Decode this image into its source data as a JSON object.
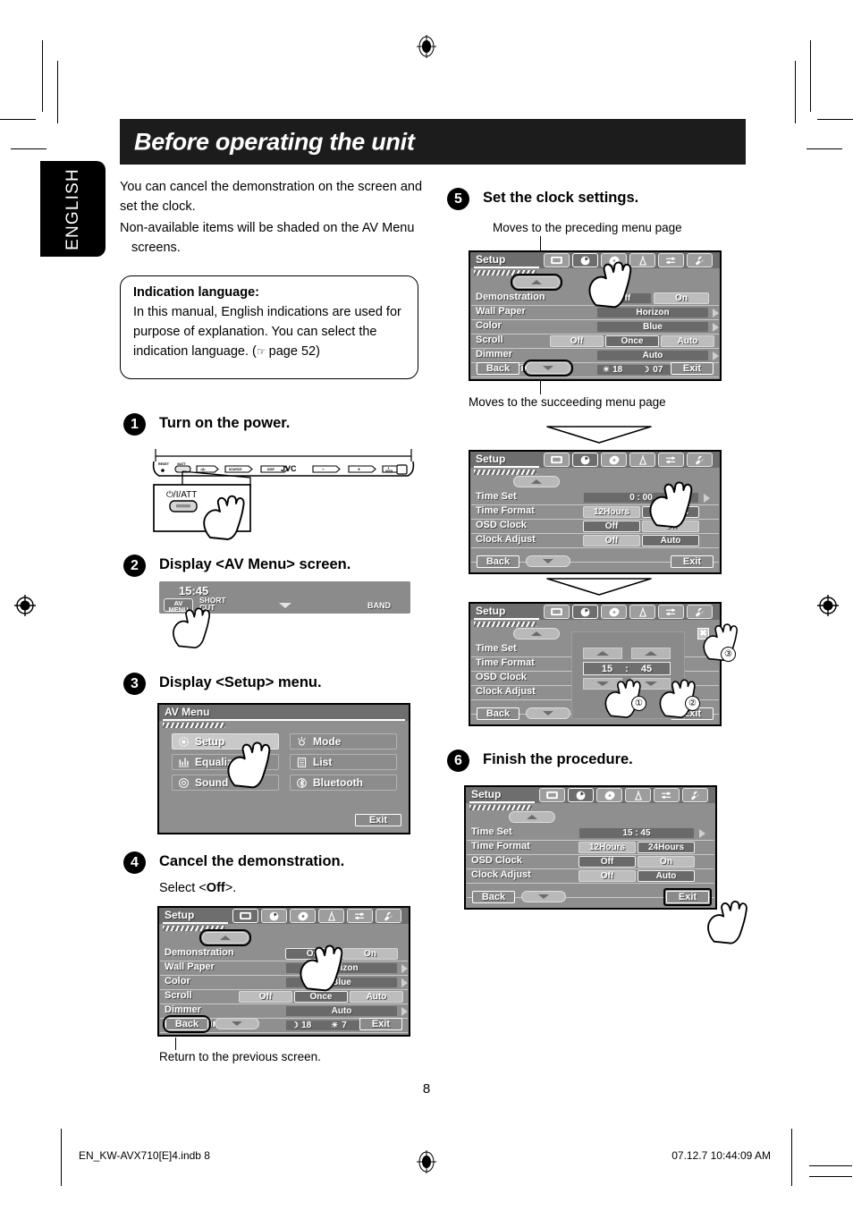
{
  "meta": {
    "language_tab": "ENGLISH",
    "page_number": "8",
    "footer_left": "EN_KW-AVX710[E]4.indb   8",
    "footer_right": "07.12.7   10:44:09 AM"
  },
  "header": {
    "title": "Before operating the unit"
  },
  "intro": {
    "line1": "You can cancel the demonstration on the screen and set the clock.",
    "bullet1": "Non-available items will be shaded on the AV Menu screens."
  },
  "note_box": {
    "heading": "Indication language:",
    "body_part1": "In this manual, English indications are used for purpose of explanation. You can select the indication language. (",
    "body_part2": " page 52)",
    "symbol": "☞"
  },
  "steps": {
    "s1": {
      "num": "1",
      "title": "Turn on the power."
    },
    "s2": {
      "num": "2",
      "title": "Display <AV Menu> screen."
    },
    "s3": {
      "num": "3",
      "title": "Display <Setup> menu."
    },
    "s4": {
      "num": "4",
      "title": "Cancel the demonstration.",
      "subtext_pre": "Select <",
      "subtext_bold": "Off",
      "subtext_post": ">.",
      "caption": "Return to the previous screen."
    },
    "s5": {
      "num": "5",
      "title": "Set the clock settings.",
      "caption_top": "Moves to the preceding menu page",
      "caption_bottom": "Moves to the succeeding menu page"
    },
    "s6": {
      "num": "6",
      "title": "Finish the procedure."
    }
  },
  "faceplate": {
    "brand": "JVC",
    "reset_label": "RESET",
    "att_label": "/I/ATT",
    "keys": [
      "◁/▷",
      "SOURCE",
      "DISP",
      "–",
      "+",
      "▲/OPEN"
    ],
    "callout_label": "/I/ATT"
  },
  "source_bar": {
    "clock": "15:45",
    "av_menu_line1": "AV",
    "av_menu_line2": "MENU",
    "shortcut_line1": "SHORT",
    "shortcut_line2": "CUT",
    "band": "BAND"
  },
  "av_menu_screen": {
    "title": "AV Menu",
    "buttons": [
      {
        "label": "Setup",
        "icon": "setup-gear-icon",
        "selected": true
      },
      {
        "label": "Mode",
        "icon": "mode-sun-icon",
        "selected": false
      },
      {
        "label": "Equalizer",
        "icon": "equalizer-bars-icon",
        "selected": false
      },
      {
        "label": "List",
        "icon": "list-icon",
        "selected": false
      },
      {
        "label": "Sound",
        "icon": "sound-speaker-icon",
        "selected": false
      },
      {
        "label": "Bluetooth",
        "icon": "bluetooth-icon",
        "selected": false
      }
    ],
    "exit": "Exit"
  },
  "setup_tabs": [
    "screen-tab-icon",
    "clock-tab-icon",
    "disc-tab-icon",
    "tuner-tab-icon",
    "audio-tab-icon",
    "wrench-tab-icon"
  ],
  "setup_screen_demo": {
    "title": "Setup",
    "selected_tab": 0,
    "rows": [
      {
        "name": "Demonstration",
        "type": "two",
        "options": [
          "Off",
          "On"
        ],
        "selected": 0
      },
      {
        "name": "Wall Paper",
        "type": "wide",
        "value": "Horizon",
        "arrow": true
      },
      {
        "name": "Color",
        "type": "wide",
        "value": "Blue",
        "arrow": true
      },
      {
        "name": "Scroll",
        "type": "three",
        "options": [
          "Off",
          "Once",
          "Auto"
        ],
        "selected": 1
      },
      {
        "name": "Dimmer",
        "type": "wide",
        "value": "Auto",
        "arrow": true
      },
      {
        "name": "Dimmer Time Set",
        "type": "dimmer",
        "night": "18",
        "day": "7"
      }
    ],
    "back": "Back",
    "exit": "Exit"
  },
  "setup_screen_demo_step5": {
    "title": "Setup",
    "selected_tab": 1,
    "rows": [
      {
        "name": "Demonstration",
        "type": "two",
        "options": [
          "Off",
          "On"
        ],
        "selected": 1
      },
      {
        "name": "Wall Paper",
        "type": "wide",
        "value": "Horizon",
        "arrow": true
      },
      {
        "name": "Color",
        "type": "wide",
        "value": "Blue",
        "arrow": true
      },
      {
        "name": "Scroll",
        "type": "three",
        "options": [
          "Off",
          "Once",
          "Auto"
        ],
        "selected": 1
      },
      {
        "name": "Dimmer",
        "type": "wide",
        "value": "Auto",
        "arrow": true
      },
      {
        "name": "Dimmer Time Set",
        "type": "dimmer",
        "night": "18",
        "day": "07"
      }
    ],
    "back": "Back",
    "exit": "Exit"
  },
  "clock_screen_a": {
    "title": "Setup",
    "selected_tab": 1,
    "rows": [
      {
        "name": "Time Set",
        "type": "wide",
        "value": "0   :   00",
        "arrow": true
      },
      {
        "name": "Time Format",
        "type": "two",
        "options": [
          "12Hours",
          "24Hours"
        ],
        "selected": 1
      },
      {
        "name": "OSD Clock",
        "type": "two",
        "options": [
          "Off",
          "On"
        ],
        "selected": 0
      },
      {
        "name": "Clock Adjust",
        "type": "two",
        "options": [
          "Off",
          "Auto"
        ],
        "selected": 1
      }
    ],
    "back": "Back",
    "exit": "Exit"
  },
  "clock_screen_b": {
    "title": "Setup",
    "selected_tab": 1,
    "rows": [
      {
        "name": "Time Set"
      },
      {
        "name": "Time Format"
      },
      {
        "name": "OSD Clock"
      },
      {
        "name": "Clock Adjust"
      }
    ],
    "popup": {
      "hours": "15",
      "sep": ":",
      "minutes": "45",
      "close": "✖"
    },
    "markers": [
      "①",
      "②",
      "③"
    ],
    "back": "Back",
    "exit": "Exit"
  },
  "clock_screen_final": {
    "title": "Setup",
    "selected_tab": 1,
    "rows": [
      {
        "name": "Time Set",
        "type": "wide",
        "value": "15   :   45",
        "arrow": true
      },
      {
        "name": "Time Format",
        "type": "two",
        "options": [
          "12Hours",
          "24Hours"
        ],
        "selected": 1
      },
      {
        "name": "OSD Clock",
        "type": "two",
        "options": [
          "Off",
          "On"
        ],
        "selected": 0
      },
      {
        "name": "Clock Adjust",
        "type": "two",
        "options": [
          "Off",
          "Auto"
        ],
        "selected": 1
      }
    ],
    "back": "Back",
    "exit": "Exit"
  }
}
